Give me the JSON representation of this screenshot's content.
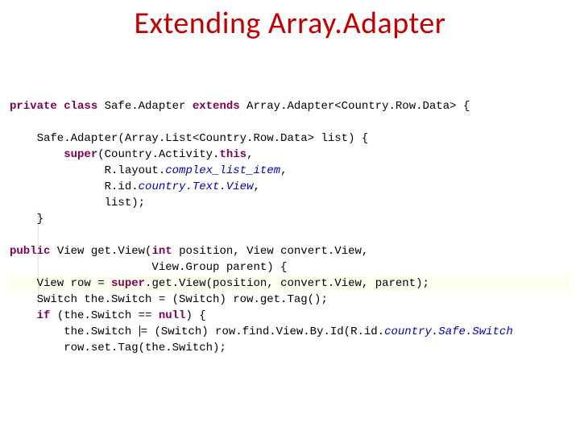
{
  "title": "Extending Array.Adapter",
  "code": {
    "l1": {
      "kw1": "private class",
      "t1": " Safe.Adapter ",
      "kw2": "extends",
      "t2": " Array.Adapter<Country.Row.Data> {"
    },
    "l3": {
      "t1": "    Safe.Adapter(Array.List<Country.Row.Data> list) {"
    },
    "l4": {
      "t1": "        ",
      "kw1": "super",
      "t2": "(Country.Activity.",
      "kw2": "this",
      "t3": ","
    },
    "l5": {
      "t1": "              R.layout.",
      "m1": "complex_list_item",
      "t2": ","
    },
    "l6": {
      "t1": "              R.id.",
      "m1": "country.Text.View",
      "t2": ","
    },
    "l7": {
      "t1": "              list);"
    },
    "l8": {
      "t1": "    }"
    },
    "l10": {
      "kw1": "public",
      "t1": " View get.View(",
      "kw2": "int",
      "t2": " position, View convert.View,"
    },
    "l11": {
      "t1": "                     View.Group parent) {"
    },
    "l12": {
      "t1": "    View row = ",
      "kw1": "super",
      "t2": ".get.View(position, convert.View, parent);"
    },
    "l13": {
      "t1": "    Switch the.Switch = (Switch) row.get.Tag();"
    },
    "l14": {
      "t1": "    ",
      "kw1": "if",
      "t2": " (the.Switch == ",
      "kw2": "null",
      "t3": ") {"
    },
    "l15": {
      "t1": "        the.Switch ",
      "cursor": true,
      "t2": "= (Switch) row.find.View.By.Id(R.id.",
      "m1": "country.Safe.Switch",
      "t3": ""
    },
    "l16": {
      "t1": "        row.set.Tag(the.Switch);"
    }
  }
}
